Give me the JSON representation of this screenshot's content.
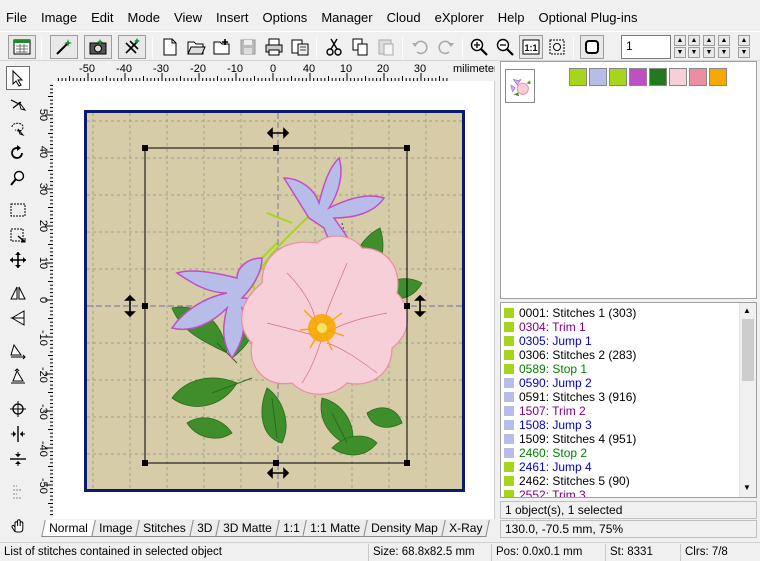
{
  "menu": [
    "File",
    "Image",
    "Edit",
    "Mode",
    "View",
    "Insert",
    "Options",
    "Manager",
    "Cloud",
    "eXplorer",
    "Help",
    "Optional Plug-ins"
  ],
  "toolbar": {
    "stitch_number": "1"
  },
  "ruler": {
    "unit": "milimeters",
    "h_ticks": [
      "-50",
      "-40",
      "-30",
      "-20",
      "-10",
      "0",
      "10",
      "20",
      "30",
      "40"
    ],
    "v_ticks": [
      "50",
      "40",
      "30",
      "20",
      "10",
      "0",
      "-10",
      "-20",
      "-30",
      "-40",
      "-50"
    ]
  },
  "palette": {
    "colors": [
      "#a5d61c",
      "#b7bde8",
      "#a5d61c",
      "#c04fc4",
      "#237a1e",
      "#f7cfd9",
      "#e88fa0",
      "#f5a800"
    ]
  },
  "objects": [
    {
      "text": "0001:  Stitches 1 (303)",
      "swatch": "#a5d61c",
      "color": "#000000"
    },
    {
      "text": "0304:  Trim 1",
      "swatch": "#a5d61c",
      "color": "#800080"
    },
    {
      "text": "0305:  Jump 1",
      "swatch": "#a5d61c",
      "color": "#0000c0"
    },
    {
      "text": "0306:  Stitches 2 (283)",
      "swatch": "#a5d61c",
      "color": "#000000"
    },
    {
      "text": "0589:  Stop 1",
      "swatch": "#a5d61c",
      "color": "#008000"
    },
    {
      "text": "0590:  Jump 2",
      "swatch": "#b7bde8",
      "color": "#0000c0"
    },
    {
      "text": "0591:  Stitches 3 (916)",
      "swatch": "#b7bde8",
      "color": "#000000"
    },
    {
      "text": "1507:  Trim 2",
      "swatch": "#b7bde8",
      "color": "#800080"
    },
    {
      "text": "1508:  Jump 3",
      "swatch": "#b7bde8",
      "color": "#0000c0"
    },
    {
      "text": "1509:  Stitches 4 (951)",
      "swatch": "#b7bde8",
      "color": "#000000"
    },
    {
      "text": "2460:  Stop 2",
      "swatch": "#b7bde8",
      "color": "#008000"
    },
    {
      "text": "2461:  Jump 4",
      "swatch": "#a5d61c",
      "color": "#0000c0"
    },
    {
      "text": "2462:  Stitches 5 (90)",
      "swatch": "#a5d61c",
      "color": "#000000"
    },
    {
      "text": "2552:  Trim 3",
      "swatch": "#a5d61c",
      "color": "#800080"
    }
  ],
  "selection_info": "1 object(s), 1 selected",
  "coords_info": "130.0, -70.5 mm, 75%",
  "tabs": [
    "Normal",
    "Image",
    "Stitches",
    "3D",
    "3D Matte",
    "1:1",
    "1:1 Matte",
    "Density Map",
    "X-Ray"
  ],
  "status": {
    "hint": "List of stitches contained in selected object",
    "size": "Size: 68.8x82.5 mm",
    "pos": "Pos: 0.0x0.1 mm",
    "st": "St: 8331",
    "clrs": "Clrs: 7/8"
  }
}
